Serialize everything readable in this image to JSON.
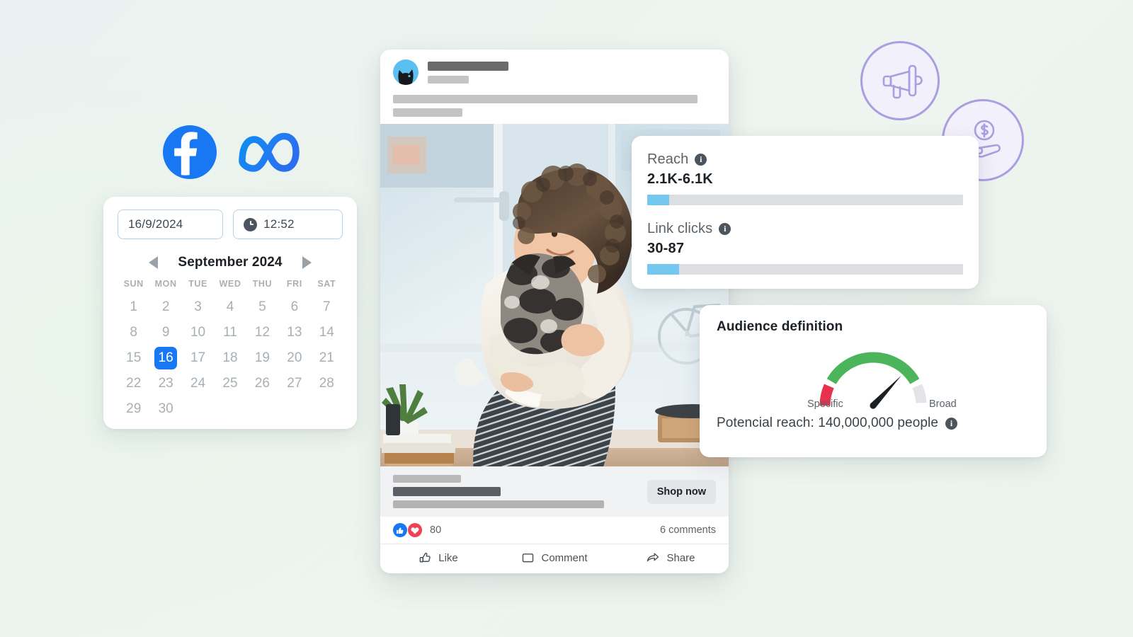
{
  "scheduler": {
    "date_value": "16/9/2024",
    "time_value": "12:52",
    "clock_icon": "clock-icon",
    "prev_icon": "chevron-left-icon",
    "next_icon": "chevron-right-icon",
    "month_title": "September 2024",
    "weekdays": [
      "SUN",
      "MON",
      "TUE",
      "WED",
      "THU",
      "FRI",
      "SAT"
    ],
    "days": [
      1,
      2,
      3,
      4,
      5,
      6,
      7,
      8,
      9,
      10,
      11,
      12,
      13,
      14,
      15,
      16,
      17,
      18,
      19,
      20,
      21,
      22,
      23,
      24,
      25,
      26,
      27,
      28,
      29,
      30
    ],
    "selected_day": 16,
    "selected_color": "#1877f2"
  },
  "logos": {
    "facebook": "facebook-logo",
    "meta": "meta-logo",
    "brand_color": "#1877f2"
  },
  "badges": {
    "megaphone": "megaphone-icon",
    "money_hand": "hand-holding-dollar-icon",
    "accent_color": "#a99fe0"
  },
  "post": {
    "avatar_icon": "cat-avatar-icon",
    "cta_label": "Shop now",
    "reaction_like_icon": "thumbs-up-icon",
    "reaction_love_icon": "heart-icon",
    "reaction_count": "80",
    "comment_count": "6 comments",
    "actions": [
      {
        "label": "Like",
        "icon": "thumbs-up-outline-icon"
      },
      {
        "label": "Comment",
        "icon": "comment-bubble-icon"
      },
      {
        "label": "Share",
        "icon": "share-arrow-icon"
      }
    ]
  },
  "estimates": {
    "reach": {
      "label": "Reach",
      "info_icon": "info-icon",
      "value": "2.1K-6.1K",
      "bar_percent": 7,
      "bar_color": "#74c7ef"
    },
    "link_clicks": {
      "label": "Link clicks",
      "info_icon": "info-icon",
      "value": "30-87",
      "bar_percent": 10,
      "bar_color": "#74c7ef"
    }
  },
  "audience": {
    "title": "Audience definition",
    "gauge": {
      "left_label": "Specific",
      "right_label": "Broad",
      "needle_position": 0.74,
      "segments": [
        {
          "name": "specific",
          "color": "#e8304f",
          "fraction": 0.15
        },
        {
          "name": "defined",
          "color": "#4cb45a",
          "fraction": 0.7
        },
        {
          "name": "broad",
          "color": "#e2e4e8",
          "fraction": 0.15
        }
      ]
    },
    "potential_reach": "Potencial reach: 140,000,000 people",
    "info_icon": "info-icon"
  }
}
